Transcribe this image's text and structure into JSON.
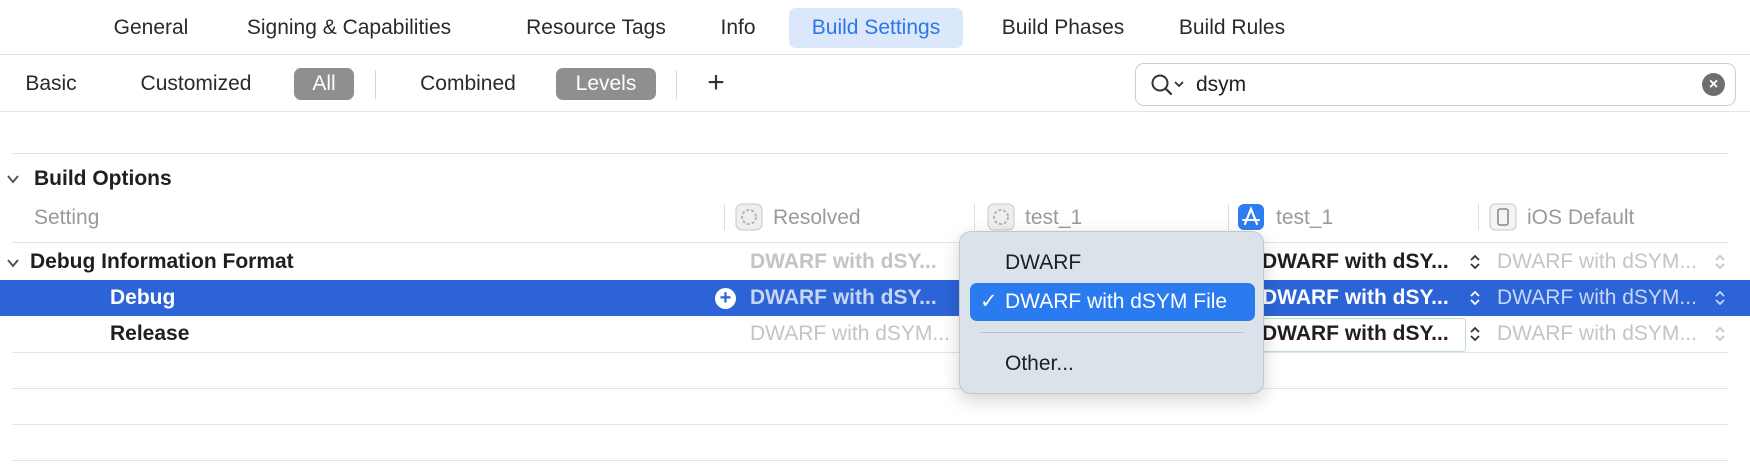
{
  "top_tabs": [
    {
      "label": "General"
    },
    {
      "label": "Signing & Capabilities"
    },
    {
      "label": "Resource Tags"
    },
    {
      "label": "Info"
    },
    {
      "label": "Build Settings",
      "active": true
    },
    {
      "label": "Build Phases"
    },
    {
      "label": "Build Rules"
    }
  ],
  "filter": {
    "basic": "Basic",
    "customized": "Customized",
    "all": "All",
    "combined": "Combined",
    "levels": "Levels",
    "add": "+"
  },
  "search": {
    "value": "dsym",
    "placeholder": ""
  },
  "section": {
    "title": "Build Options"
  },
  "columns": {
    "setting": "Setting",
    "resolved": "Resolved",
    "project": "test_1",
    "target": "test_1",
    "ios_default": "iOS Default"
  },
  "rows": [
    {
      "label": "Debug Information Format",
      "resolved": "DWARF with dSY...",
      "target": "DWARF with dSY...",
      "ios_default": "DWARF with dSYM..."
    },
    {
      "label": "Debug",
      "resolved": "DWARF with dSY...",
      "target": "DWARF with dSY...",
      "ios_default": "DWARF with dSYM..."
    },
    {
      "label": "Release",
      "resolved": "DWARF with dSYM...",
      "target": "DWARF with dSY...",
      "ios_default": "DWARF with dSYM..."
    }
  ],
  "popup": {
    "items": [
      "DWARF",
      "DWARF with dSYM File"
    ],
    "selected": "DWARF with dSYM File",
    "checkmark": "✓",
    "other": "Other..."
  },
  "colors": {
    "accent": "#2b78e4",
    "selection": "#2c64d8",
    "menu_highlight": "#2a7bf0"
  }
}
